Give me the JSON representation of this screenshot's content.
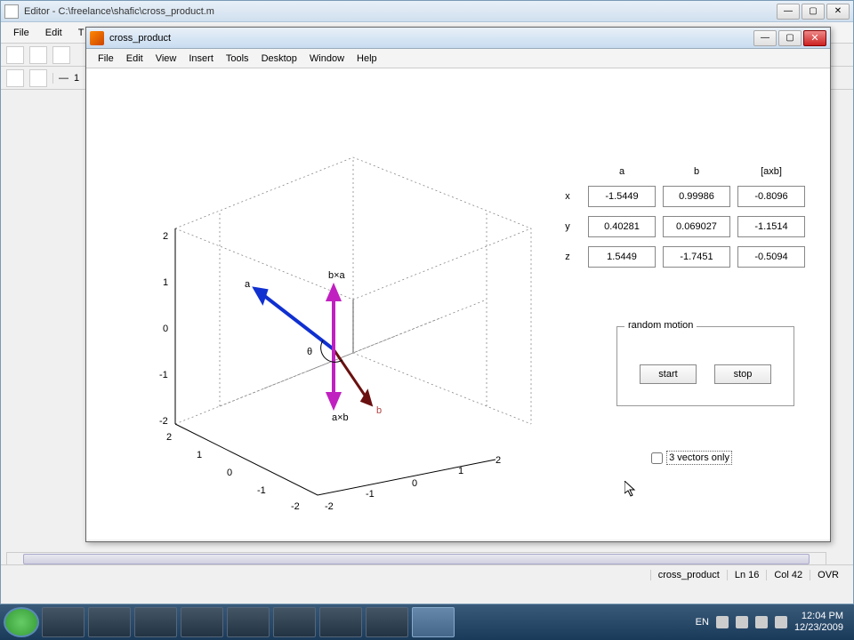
{
  "editor": {
    "title": "Editor - C:\\freelance\\shafic\\cross_product.m",
    "menu": [
      "File",
      "Edit",
      "T"
    ],
    "line_num": "1"
  },
  "figure": {
    "title": "cross_product",
    "menu": [
      "File",
      "Edit",
      "View",
      "Insert",
      "Tools",
      "Desktop",
      "Window",
      "Help"
    ]
  },
  "headers": {
    "a": "a",
    "b": "b",
    "axb": "[axb]"
  },
  "rows": {
    "x": "x",
    "y": "y",
    "z": "z"
  },
  "values": {
    "ax": "-1.5449",
    "bx": "0.99986",
    "cx": "-0.8096",
    "ay": "0.40281",
    "by": "0.069027",
    "cy": "-1.1514",
    "az": "1.5449",
    "bz": "-1.7451",
    "cz": "-0.5094"
  },
  "random": {
    "legend": "random motion",
    "start": "start",
    "stop": "stop"
  },
  "checkbox": {
    "label": "3 vectors only"
  },
  "plot": {
    "ticks": [
      "2",
      "1",
      "0",
      "-1",
      "-2"
    ],
    "labels": {
      "a": "a",
      "b": "b",
      "axb": "a×b",
      "bxa": "b×a",
      "theta": "θ"
    }
  },
  "status": {
    "file": "cross_product",
    "ln": "Ln  16",
    "col": "Col  42",
    "ovr": "OVR"
  },
  "tray": {
    "lang": "EN",
    "time": "12:04 PM",
    "date": "12/23/2009"
  },
  "chart_data": {
    "type": "3d-vector",
    "axis_range": [
      -2,
      2
    ],
    "ticks": [
      -2,
      -1,
      0,
      1,
      2
    ],
    "vectors": {
      "a": {
        "x": -1.5449,
        "y": 0.40281,
        "z": 1.5449,
        "color": "blue"
      },
      "b": {
        "x": 0.99986,
        "y": 0.069027,
        "z": -1.7451,
        "color": "darkred"
      },
      "axb": {
        "x": -0.8096,
        "y": -1.1514,
        "z": -0.5094,
        "color": "magenta",
        "label": "a×b"
      },
      "bxa": {
        "x": 0.8096,
        "y": 1.1514,
        "z": 0.5094,
        "color": "magenta",
        "label": "b×a"
      }
    },
    "angle_label": "θ"
  }
}
